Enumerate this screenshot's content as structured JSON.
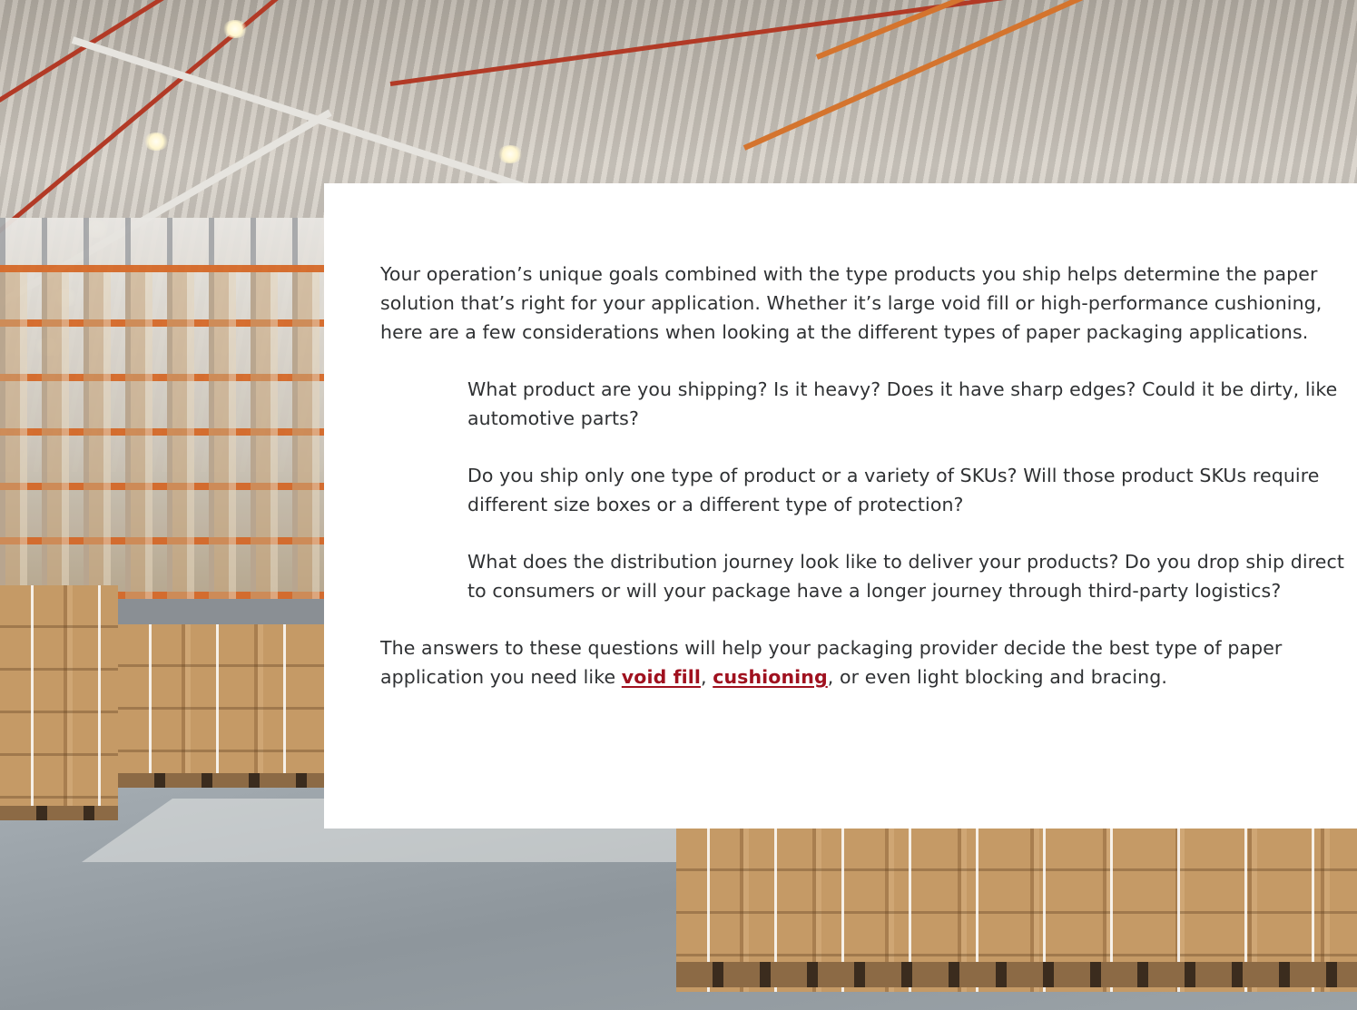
{
  "article": {
    "intro": "Your operation’s unique goals combined with the type products you ship helps determine the paper solution that’s right for your application. Whether it’s large void fill or high-performance cushioning, here are a few considerations when looking at the different types of paper packaging applications.",
    "questions": [
      "What product are you shipping? Is it heavy? Does it have sharp edges? Could it be dirty, like automotive parts?",
      "Do you ship only one type of product or a variety of SKUs? Will those product SKUs require different size boxes or a different type of protection?",
      "What does the distribution journey look like to deliver your products? Do you drop ship direct to consumers or will your package have a longer journey through third-party logistics?"
    ],
    "conclusion": {
      "before": "The answers to these questions will help your packaging provider decide the best type of paper application you need like ",
      "link1": "void fill",
      "between": ", ",
      "link2": "cushioning",
      "after": ", or even light blocking and bracing."
    }
  },
  "colors": {
    "link": "#a0111f",
    "body_text": "#2f3133",
    "card_background": "#ffffff"
  }
}
